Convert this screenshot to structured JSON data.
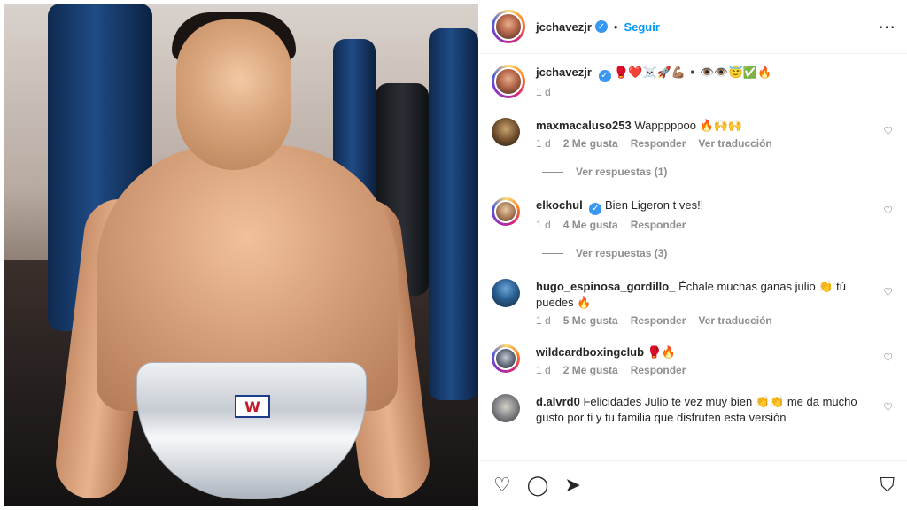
{
  "post": {
    "username": "jcchavezjr",
    "follow_label": "Seguir",
    "more_icon": "more-horizontal-icon",
    "caption": {
      "username": "jcchavezjr",
      "text": "🥊❤️☠️🚀💪🏽▪️👁️👁️😇✅🔥",
      "time": "1 d"
    }
  },
  "comments": [
    {
      "username": "maxmacaluso253",
      "text": "Wapppppoo 🔥🙌🙌",
      "time": "1 d",
      "likes": "2 Me gusta",
      "reply": "Responder",
      "translate": "Ver traducción",
      "view_replies": "Ver respuestas (1)",
      "verified": false
    },
    {
      "username": "elkochul",
      "text": "Bien Ligeron t ves!!",
      "time": "1 d",
      "likes": "4 Me gusta",
      "reply": "Responder",
      "view_replies": "Ver respuestas (3)",
      "verified": true
    },
    {
      "username": "hugo_espinosa_gordillo_",
      "text": "Échale muchas ganas julio 👏 tú puedes 🔥",
      "time": "1 d",
      "likes": "5 Me gusta",
      "reply": "Responder",
      "translate": "Ver traducción",
      "verified": false
    },
    {
      "username": "wildcardboxingclub",
      "text": "🥊🔥",
      "time": "1 d",
      "likes": "2 Me gusta",
      "reply": "Responder",
      "verified": false
    },
    {
      "username": "d.alvrd0",
      "text": "Felicidades Julio te vez muy bien 👏👏 me da mucho gusto por ti y tu familia que disfruten esta versión",
      "time": "",
      "likes": "",
      "reply": "",
      "verified": false
    }
  ],
  "actions": {
    "like_icon": "heart-icon",
    "comment_icon": "comment-icon",
    "share_icon": "share-icon",
    "save_icon": "bookmark-icon"
  },
  "colors": {
    "accent_blue": "#0095f6",
    "text": "#262626",
    "muted": "#8e8e8e",
    "verified": "#3897f0"
  }
}
